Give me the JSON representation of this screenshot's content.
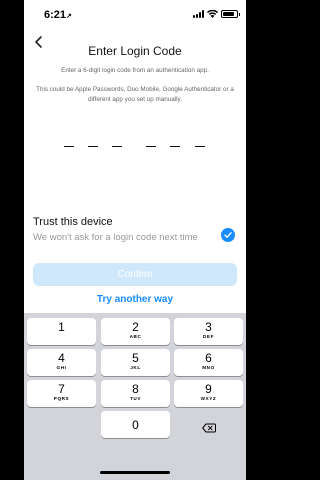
{
  "status": {
    "time": "6:21",
    "time_arrow": "↗",
    "battery_level": 0.85
  },
  "header": {
    "title": "Enter Login Code",
    "back_icon": "chevron-left-icon"
  },
  "instruction": "Enter a 6-digit login code from an authentication app.",
  "detail": "This could be Apple Passwords, Duo Mobile, Google Authenticator or a different app you set up manually.",
  "code": {
    "digits_entered": 0,
    "length": 6
  },
  "trust": {
    "label": "Trust this device",
    "sublabel": "We won't ask for a login code next time",
    "checked": true
  },
  "confirm_label": "Confirm",
  "try_another_label": "Try another way",
  "keypad": {
    "keys": [
      {
        "num": "1",
        "letters": ""
      },
      {
        "num": "2",
        "letters": "ABC"
      },
      {
        "num": "3",
        "letters": "DEF"
      },
      {
        "num": "4",
        "letters": "GHI"
      },
      {
        "num": "5",
        "letters": "JKL"
      },
      {
        "num": "6",
        "letters": "MNO"
      },
      {
        "num": "7",
        "letters": "PQRS"
      },
      {
        "num": "8",
        "letters": "TUV"
      },
      {
        "num": "9",
        "letters": "WXYZ"
      },
      {
        "num": "0",
        "letters": ""
      }
    ],
    "backspace_icon": "backspace-icon"
  },
  "colors": {
    "accent": "#1a8cff",
    "confirm_disabled": "#cfe8fb",
    "keypad_bg": "#d2d4d9"
  }
}
